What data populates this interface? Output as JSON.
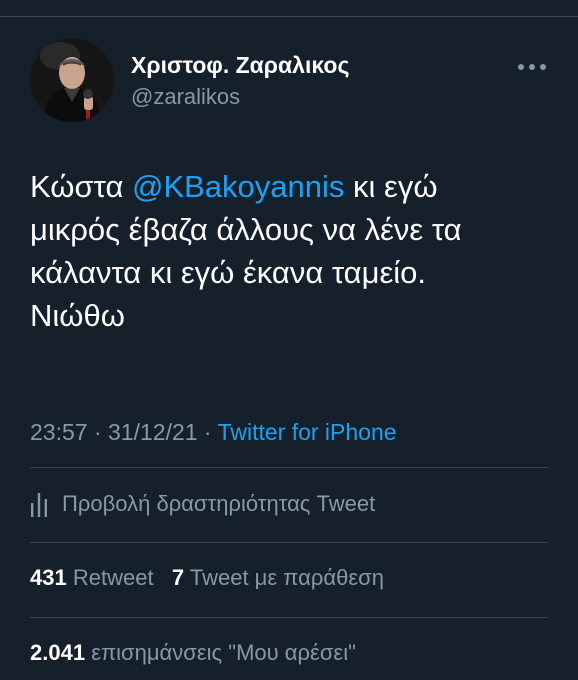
{
  "user": {
    "display_name": "Χριστοφ. Ζαραλικος",
    "handle": "@zaralikos"
  },
  "tweet": {
    "line1_before": "Κώστα ",
    "mention": "@KBakoyannis",
    "line1_after": " κι εγώ",
    "line2": "μικρός έβαζα άλλους να λένε τα",
    "line3": "κάλαντα κι εγώ έκανα ταμείο.",
    "line4": "Νιώθω"
  },
  "meta": {
    "time": "23:57",
    "separator": " · ",
    "date": "31/12/21",
    "separator2": " · ",
    "source": "Twitter for iPhone"
  },
  "activity": {
    "label": "Προβολή δραστηριότητας Tweet",
    "icon": "bar-chart-icon"
  },
  "stats": {
    "retweets_count": "431",
    "retweets_label": "Retweet",
    "quotes_count": "7",
    "quotes_label": "Tweet με παράθεση",
    "likes_count": "2.041",
    "likes_label": "επισημάνσεις \"Μου αρέσει\""
  },
  "colors": {
    "background": "#15202b",
    "accent": "#1da1f2",
    "secondary_text": "#8899a6",
    "divider": "#38444d"
  }
}
